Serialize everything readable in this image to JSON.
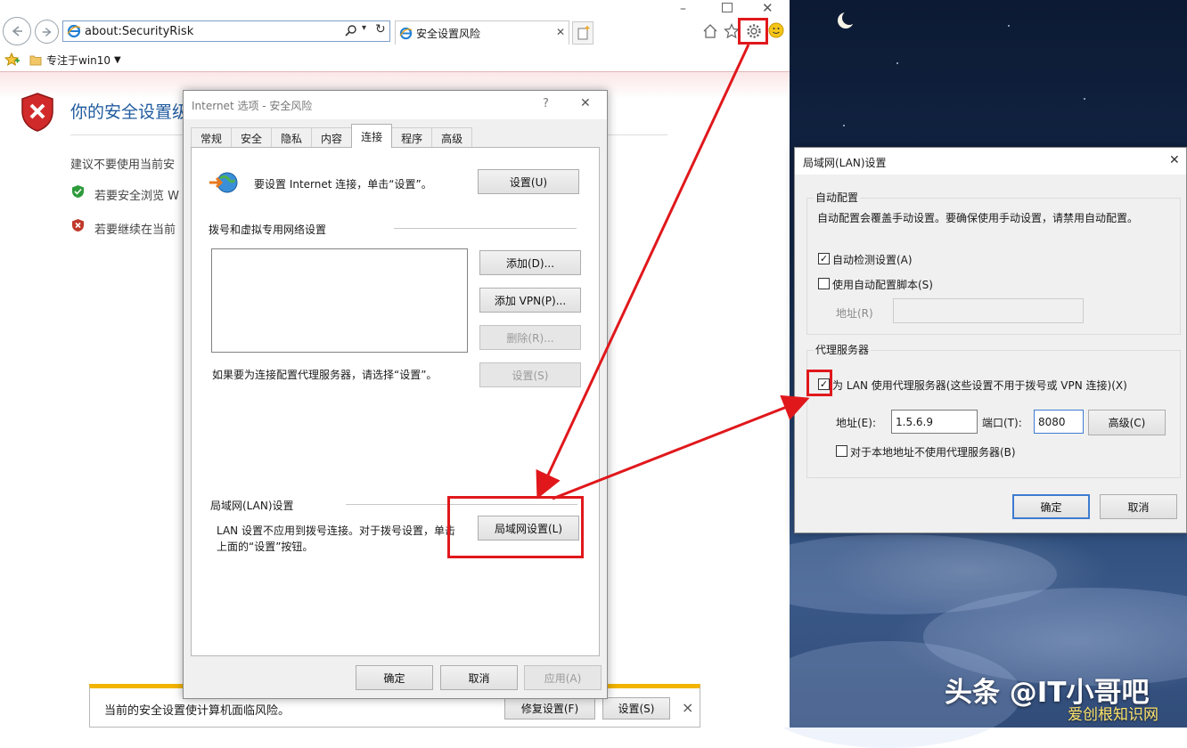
{
  "browser": {
    "address_text": "about:SecurityRisk",
    "tab_title": "安全设置风险",
    "favorites_item": "专注于win10",
    "page_heading": "你的安全设置级",
    "page_line1": "建议不要使用当前安",
    "page_item1": "若要安全浏览 W",
    "page_item2": "若要继续在当前"
  },
  "notification": {
    "message": "当前的安全设置使计算机面临风险。",
    "fix_label": "修复设置(F)",
    "settings_label": "设置(S)",
    "close": "×"
  },
  "internet_options": {
    "title": "Internet 选项 - 安全风险",
    "help": "?",
    "close": "✕",
    "tabs": [
      {
        "label": "常规"
      },
      {
        "label": "安全"
      },
      {
        "label": "隐私"
      },
      {
        "label": "内容"
      },
      {
        "label": "连接"
      },
      {
        "label": "程序"
      },
      {
        "label": "高级"
      }
    ],
    "setup_text": "要设置 Internet 连接，单击“设置”。",
    "setup_button": "设置(U)",
    "dialup_heading": "拨号和虚拟专用网络设置",
    "add_button": "添加(D)...",
    "add_vpn_button": "添加 VPN(P)...",
    "remove_button": "删除(R)...",
    "proxy_hint": "如果要为连接配置代理服务器，请选择“设置”。",
    "settings_button": "设置(S)",
    "lan_heading": "局域网(LAN)设置",
    "lan_text_1": "LAN 设置不应用到拨号连接。对于拨号设置，单击",
    "lan_text_2": "上面的“设置”按钮。",
    "lan_button": "局域网设置(L)",
    "ok": "确定",
    "cancel": "取消",
    "apply": "应用(A)"
  },
  "lan_settings": {
    "title": "局域网(LAN)设置",
    "close": "✕",
    "auto_group": "自动配置",
    "auto_desc": "自动配置会覆盖手动设置。要确保使用手动设置，请禁用自动配置。",
    "auto_detect": "自动检测设置(A)",
    "auto_detect_checked": true,
    "use_script": "使用自动配置脚本(S)",
    "use_script_checked": false,
    "script_address_label": "地址(R)",
    "script_address_value": "",
    "proxy_group": "代理服务器",
    "use_proxy": "为 LAN 使用代理服务器(这些设置不用于拨号或 VPN 连接)(X)",
    "use_proxy_checked": true,
    "address_label": "地址(E):",
    "address_value": "1.5.6.9",
    "port_label": "端口(T):",
    "port_value": "8080",
    "advanced_button": "高级(C)",
    "bypass_local": "对于本地地址不使用代理服务器(B)",
    "bypass_local_checked": false,
    "ok": "确定",
    "cancel": "取消"
  },
  "watermark": {
    "main": "头条 @IT小哥吧",
    "sub": "爱创根知识网"
  },
  "colors": {
    "annotation_red": "#e0181c",
    "accent_blue": "#3d7bd0",
    "warning_yellow": "#f2b400"
  }
}
